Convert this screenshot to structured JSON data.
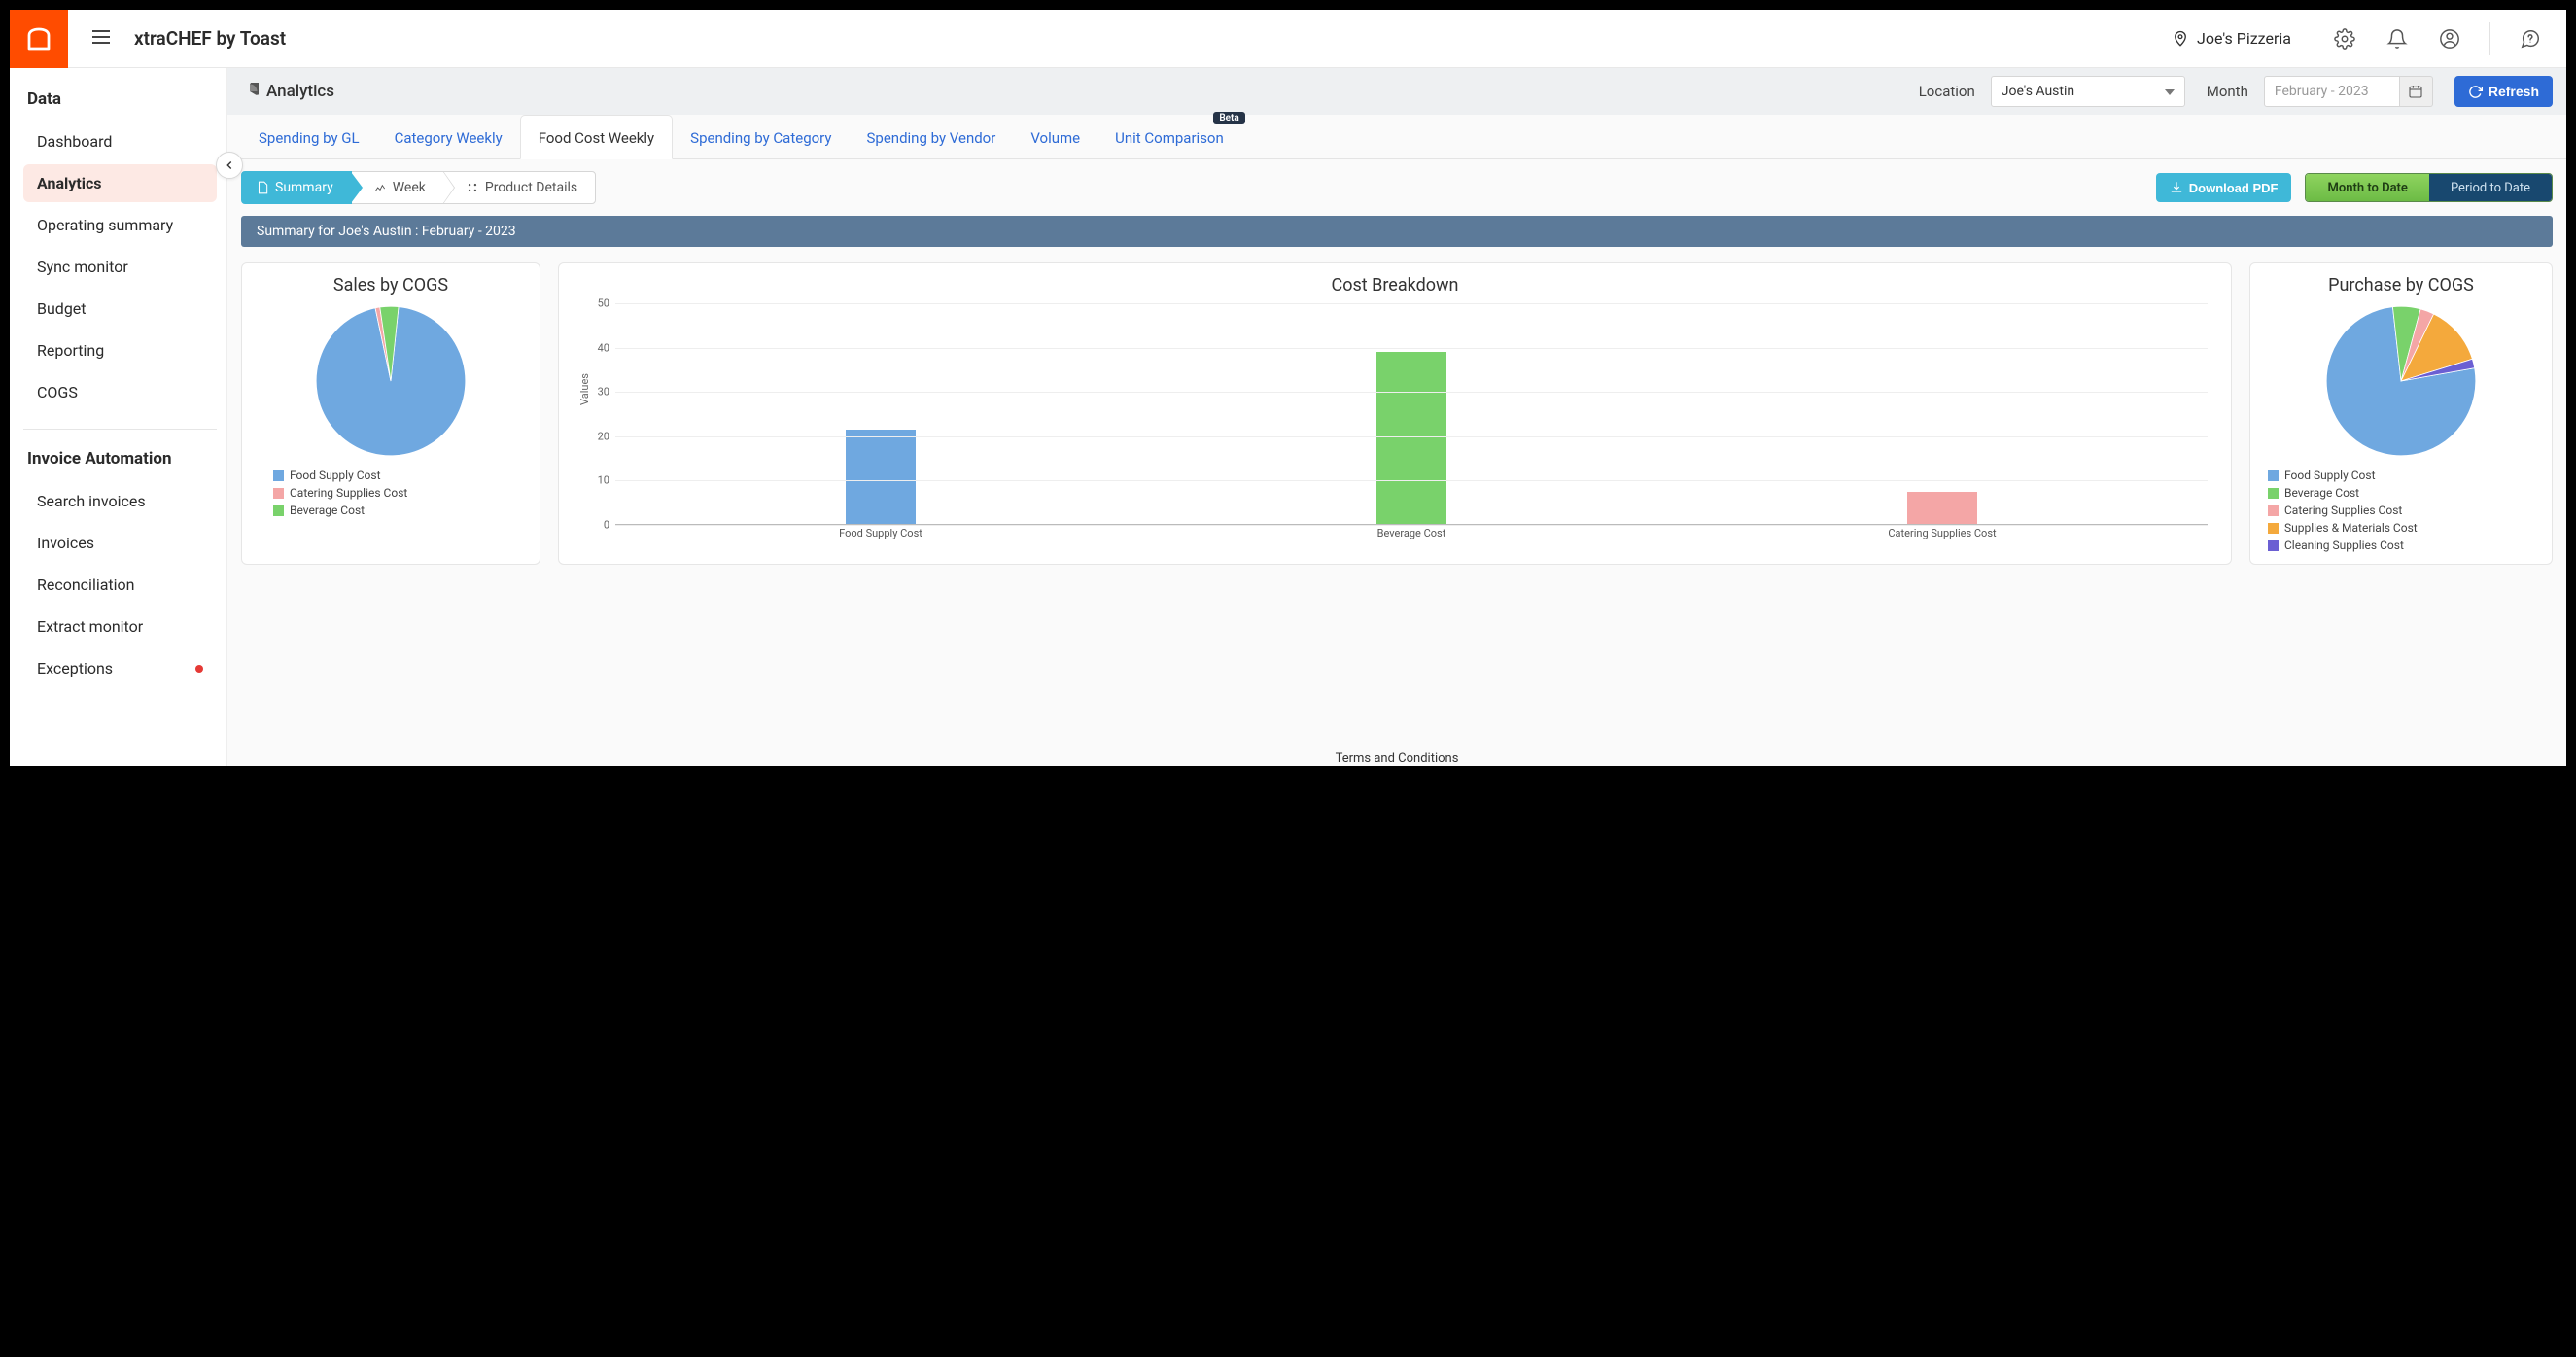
{
  "brand": "xtraCHEF by Toast",
  "top_location": "Joe's Pizzeria",
  "sidebar": {
    "section1_title": "Data",
    "section2_title": "Invoice Automation",
    "items1": [
      {
        "label": "Dashboard"
      },
      {
        "label": "Analytics"
      },
      {
        "label": "Operating summary"
      },
      {
        "label": "Sync monitor"
      },
      {
        "label": "Budget"
      },
      {
        "label": "Reporting"
      },
      {
        "label": "COGS"
      }
    ],
    "items2": [
      {
        "label": "Search invoices"
      },
      {
        "label": "Invoices"
      },
      {
        "label": "Reconciliation"
      },
      {
        "label": "Extract monitor"
      },
      {
        "label": "Exceptions"
      }
    ]
  },
  "analytics": {
    "page_title": "Analytics",
    "location_label": "Location",
    "location_value": "Joe's Austin",
    "month_label": "Month",
    "month_placeholder": "February - 2023",
    "refresh": "Refresh"
  },
  "tabs": [
    {
      "label": "Spending by GL"
    },
    {
      "label": "Category Weekly"
    },
    {
      "label": "Food Cost Weekly"
    },
    {
      "label": "Spending by Category"
    },
    {
      "label": "Spending by Vendor"
    },
    {
      "label": "Volume"
    },
    {
      "label": "Unit Comparison",
      "badge": "Beta"
    }
  ],
  "subtabs": [
    {
      "label": "Summary"
    },
    {
      "label": "Week"
    },
    {
      "label": "Product Details"
    }
  ],
  "actions": {
    "download": "Download PDF",
    "mtd": "Month to Date",
    "ptd": "Period to Date"
  },
  "summary_banner": "Summary for Joe's Austin : February - 2023",
  "cards": {
    "sales_title": "Sales by COGS",
    "cost_title": "Cost Breakdown",
    "purchase_title": "Purchase by COGS",
    "ylabel": "Values"
  },
  "footer": "Terms and Conditions",
  "chart_data": [
    {
      "id": "sales_by_cogs",
      "type": "pie",
      "title": "Sales by COGS",
      "series": [
        {
          "name": "Food Supply Cost",
          "value": 95,
          "color": "#6fa8e0"
        },
        {
          "name": "Catering Supplies Cost",
          "value": 1,
          "color": "#f4a6a6"
        },
        {
          "name": "Beverage Cost",
          "value": 4,
          "color": "#79d26b"
        }
      ]
    },
    {
      "id": "cost_breakdown",
      "type": "bar",
      "title": "Cost Breakdown",
      "ylabel": "Values",
      "ylim": [
        0,
        50
      ],
      "yticks": [
        0,
        10,
        20,
        30,
        40,
        50
      ],
      "categories": [
        "Food Supply Cost",
        "Beverage Cost",
        "Catering Supplies Cost"
      ],
      "series": [
        {
          "name": "Value",
          "values": [
            21.5,
            39,
            7.5
          ],
          "colors": [
            "#6fa8e0",
            "#79d26b",
            "#f4a6a6"
          ]
        }
      ]
    },
    {
      "id": "purchase_by_cogs",
      "type": "pie",
      "title": "Purchase by COGS",
      "series": [
        {
          "name": "Food Supply Cost",
          "value": 76,
          "color": "#6fa8e0"
        },
        {
          "name": "Beverage Cost",
          "value": 6,
          "color": "#79d26b"
        },
        {
          "name": "Catering Supplies Cost",
          "value": 3,
          "color": "#f4a6a6"
        },
        {
          "name": "Supplies & Materials Cost",
          "value": 13,
          "color": "#f4a93c"
        },
        {
          "name": "Cleaning Supplies Cost",
          "value": 2,
          "color": "#6b5fd3"
        }
      ]
    }
  ]
}
